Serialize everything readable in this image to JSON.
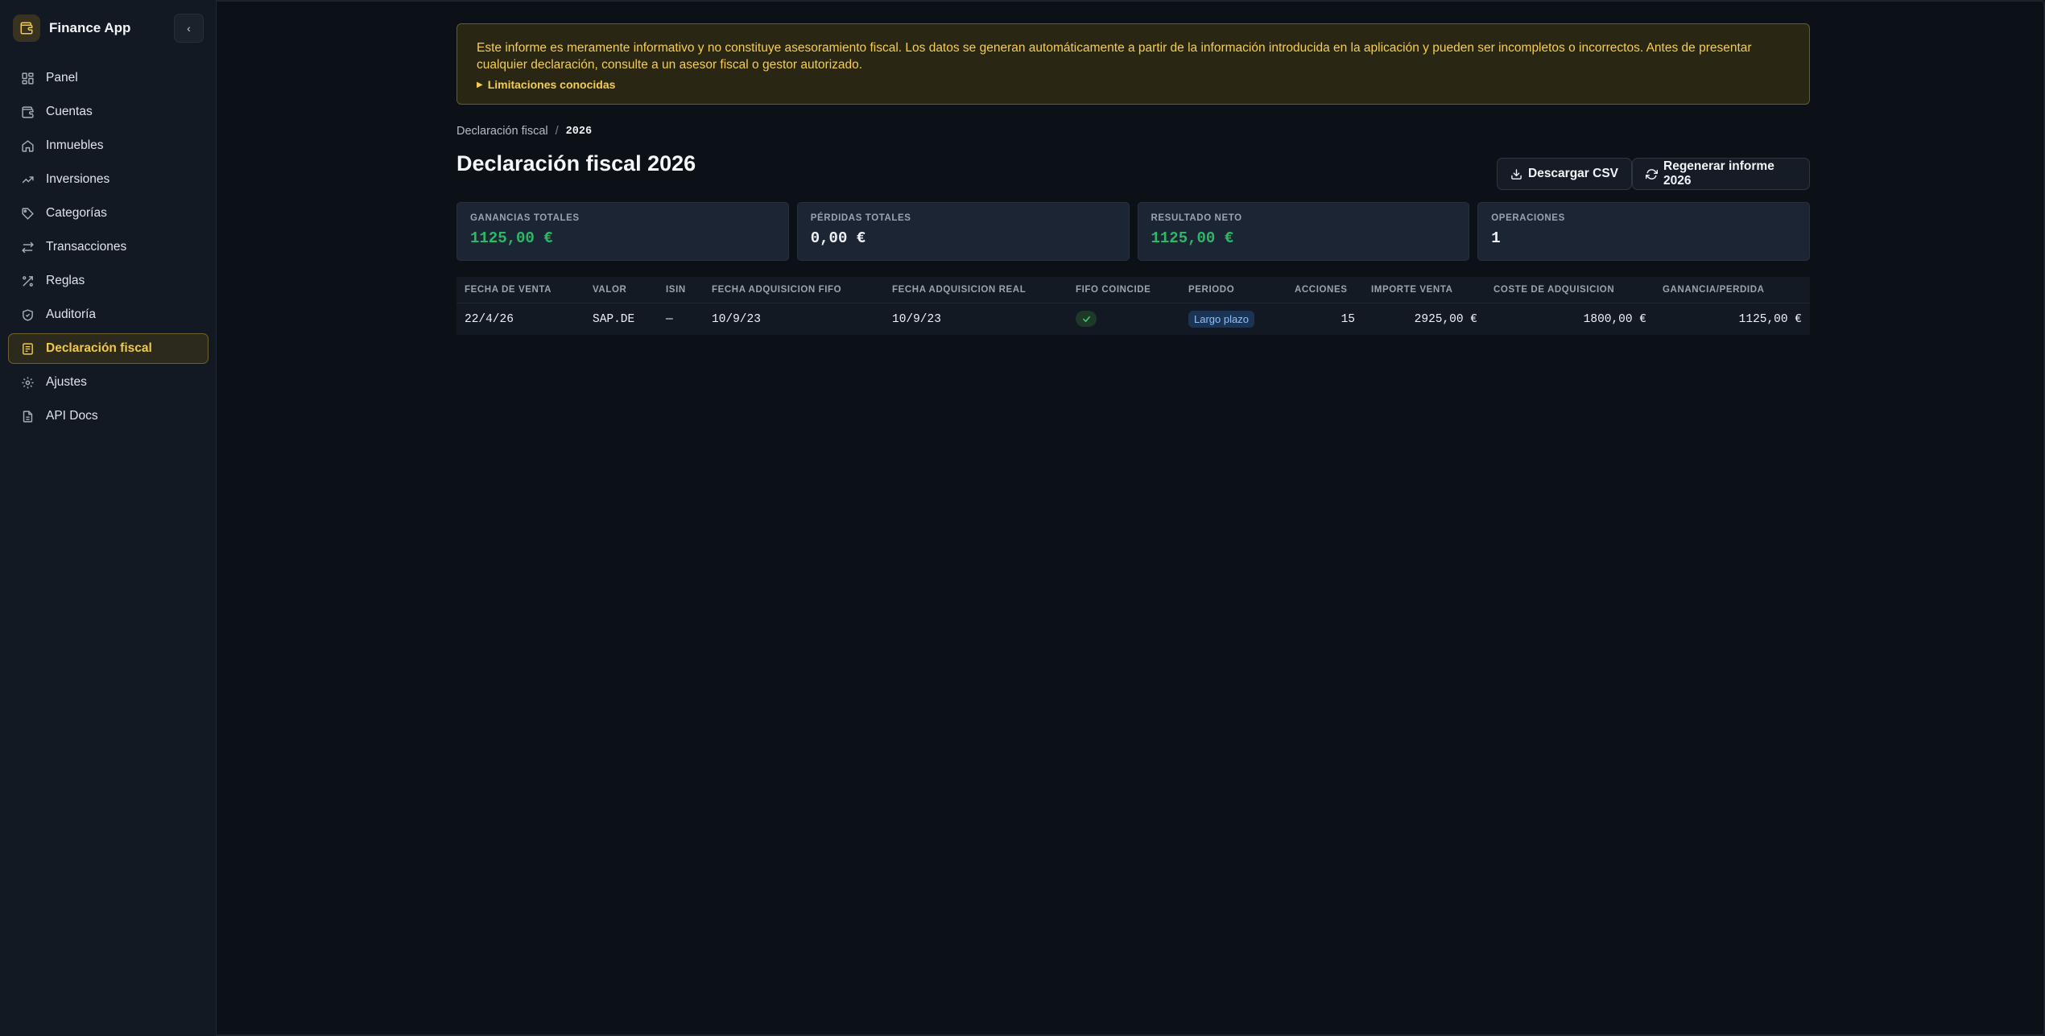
{
  "app": {
    "name": "Finance App",
    "collapse_label": "‹"
  },
  "colors": {
    "accent": "#f0c94a",
    "positive": "#2fb767",
    "neutral": "#eef1f5"
  },
  "sidebar": {
    "items": [
      {
        "label": "Panel",
        "icon": "dashboard-icon"
      },
      {
        "label": "Cuentas",
        "icon": "wallet-icon"
      },
      {
        "label": "Inmuebles",
        "icon": "home-icon"
      },
      {
        "label": "Inversiones",
        "icon": "trending-up-icon"
      },
      {
        "label": "Categorías",
        "icon": "tag-icon"
      },
      {
        "label": "Transacciones",
        "icon": "arrows-swap-icon"
      },
      {
        "label": "Reglas",
        "icon": "rules-icon"
      },
      {
        "label": "Auditoría",
        "icon": "shield-icon"
      },
      {
        "label": "Declaración fiscal",
        "icon": "receipt-icon",
        "active": true
      },
      {
        "label": "Ajustes",
        "icon": "gear-icon"
      },
      {
        "label": "API Docs",
        "icon": "document-icon"
      }
    ]
  },
  "disclaimer": {
    "text": "Este informe es meramente informativo y no constituye asesoramiento fiscal. Los datos se generan automáticamente a partir de la información introducida en la aplicación y pueden ser incompletos o incorrectos. Antes de presentar cualquier declaración, consulte a un asesor fiscal o gestor autorizado.",
    "summary": "Limitaciones conocidas"
  },
  "breadcrumb": {
    "parent": "Declaración fiscal",
    "separator": "/",
    "current": "2026"
  },
  "page": {
    "title": "Declaración fiscal 2026"
  },
  "actions": {
    "download_csv": "Descargar CSV",
    "regenerate": "Regenerar informe 2026"
  },
  "stats": [
    {
      "label": "GANANCIAS TOTALES",
      "value": "1125,00 €",
      "tone": "positive"
    },
    {
      "label": "PÉRDIDAS TOTALES",
      "value": "0,00 €",
      "tone": "neutral"
    },
    {
      "label": "RESULTADO NETO",
      "value": "1125,00 €",
      "tone": "positive"
    },
    {
      "label": "OPERACIONES",
      "value": "1",
      "tone": "neutral"
    }
  ],
  "table": {
    "headers": [
      "FECHA DE VENTA",
      "VALOR",
      "ISIN",
      "FECHA ADQUISICIÓN FIFO",
      "FECHA ADQUISICIÓN REAL",
      "FIFO COINCIDE",
      "PERÍODO",
      "ACCIONES",
      "IMPORTE VENTA",
      "COSTE DE ADQUISICIÓN",
      "GANANCIA/PÉRDIDA"
    ],
    "rows": [
      {
        "sale_date": "22/4/26",
        "security": "SAP.DE",
        "isin": "—",
        "fifo_date": "10/9/23",
        "real_date": "10/9/23",
        "fifo_match": true,
        "period": "Largo plazo",
        "shares": "15",
        "sale_amount": "2925,00 €",
        "cost": "1800,00 €",
        "gain": "1125,00 €"
      }
    ]
  }
}
